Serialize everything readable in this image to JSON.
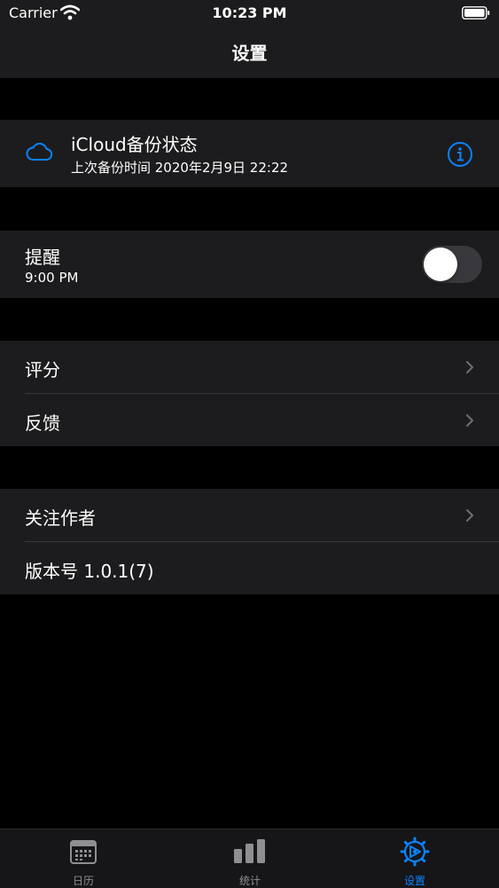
{
  "status_bar": {
    "carrier": "Carrier",
    "time": "10:23 PM"
  },
  "nav": {
    "title": "设置"
  },
  "icloud": {
    "title": "iCloud备份状态",
    "subtitle": "上次备份时间 2020年2月9日 22:22"
  },
  "reminder": {
    "title": "提醒",
    "time": "9:00 PM",
    "enabled": false
  },
  "section2": {
    "rate": "评分",
    "feedback": "反馈"
  },
  "section3": {
    "follow": "关注作者",
    "version": "版本号 1.0.1(7)"
  },
  "tabs": [
    {
      "label": "日历",
      "active": false
    },
    {
      "label": "统计",
      "active": false
    },
    {
      "label": "设置",
      "active": true
    }
  ],
  "colors": {
    "accent": "#0a84ff",
    "background": "#000000",
    "cell": "#1c1c1e",
    "inactive": "#8e8e93"
  }
}
